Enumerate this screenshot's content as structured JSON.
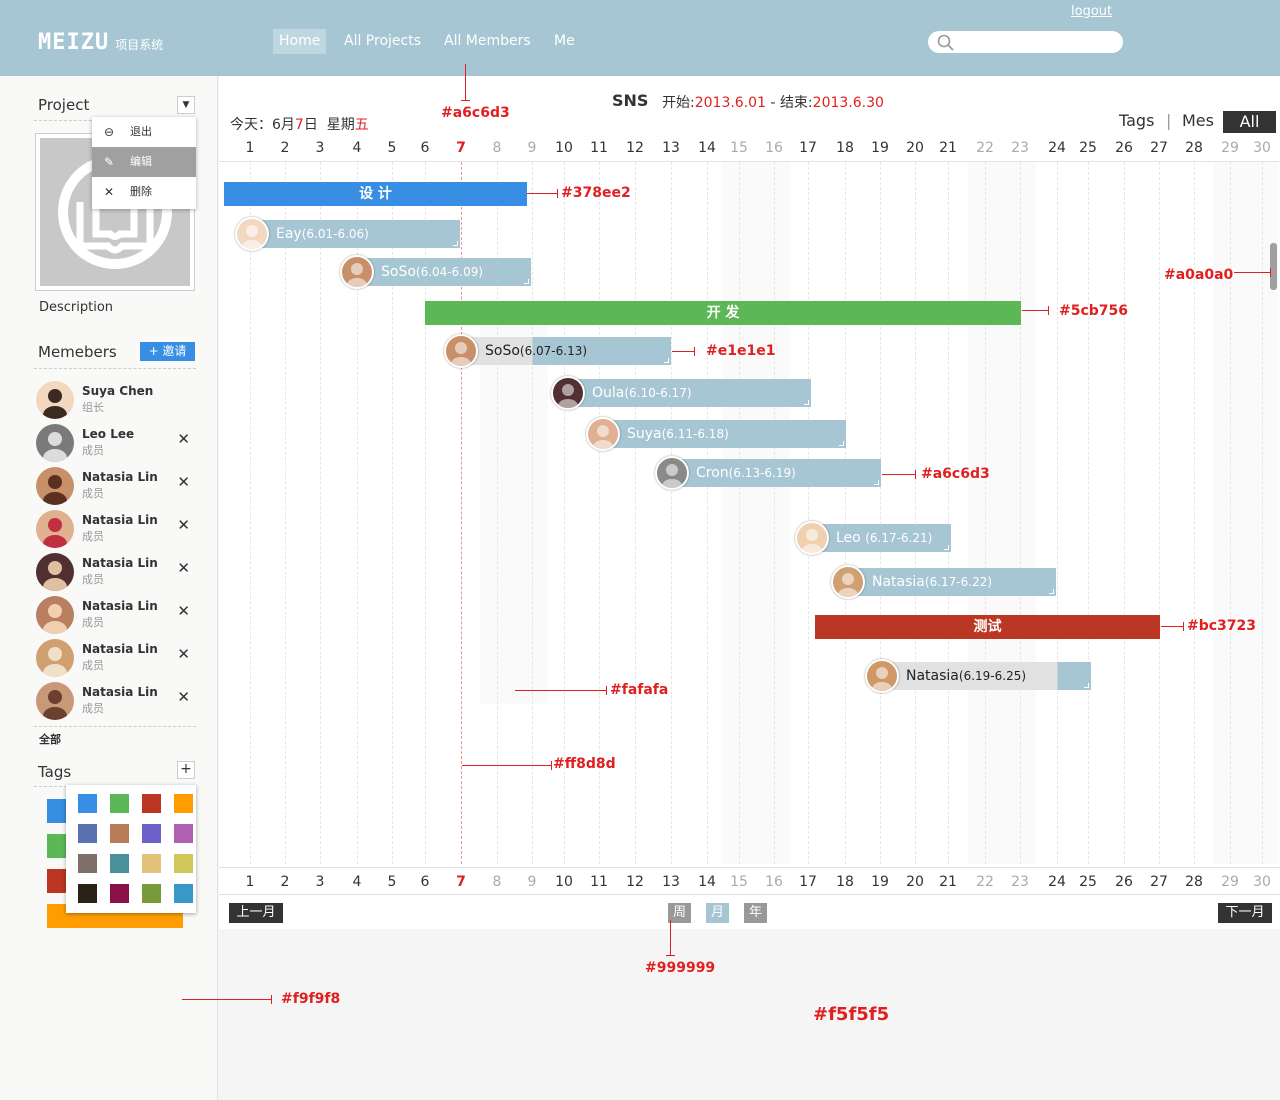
{
  "header": {
    "logo": "MEIZU",
    "logo_sub": "项目系统",
    "nav": [
      "Home",
      "All Projects",
      "All Members",
      "Me"
    ],
    "logout": "logout"
  },
  "sidebar": {
    "project_title": "Project",
    "menu": [
      "退出",
      "编辑",
      "删除"
    ],
    "description": "Description",
    "members_title": "Memebers",
    "invite": "+ 邀请",
    "members": [
      {
        "name": "Suya Chen",
        "role": "组长",
        "removable": false
      },
      {
        "name": "Leo Lee",
        "role": "成员",
        "removable": true
      },
      {
        "name": "Natasia Lin",
        "role": "成员",
        "removable": true
      },
      {
        "name": "Natasia Lin",
        "role": "成员",
        "removable": true
      },
      {
        "name": "Natasia Lin",
        "role": "成员",
        "removable": true
      },
      {
        "name": "Natasia Lin",
        "role": "成员",
        "removable": true
      },
      {
        "name": "Natasia Lin",
        "role": "成员",
        "removable": true
      },
      {
        "name": "Natasia Lin",
        "role": "成员",
        "removable": true
      }
    ],
    "all_link": "全部",
    "tags_title": "Tags",
    "tag_colors": [
      "#378ee2",
      "#5cb756",
      "#bc3723",
      "#ff9d00"
    ],
    "palette": [
      "#378ee2",
      "#5cb756",
      "#bc3723",
      "#ff9d00",
      "#5a73b0",
      "#b87c56",
      "#6c60c8",
      "#b060b0",
      "#7d7068",
      "#4a9098",
      "#e2c17a",
      "#d0c85a",
      "#2a2218",
      "#8a1048",
      "#789a38",
      "#3a98c8"
    ]
  },
  "project": {
    "name": "SNS",
    "start_label": "开始:",
    "start": "2013.6.01",
    "sep": " - ",
    "end_label": "结束:",
    "end": "2013.6.30"
  },
  "today": {
    "prefix": "今天：6月",
    "day": "7",
    "mid": "日  星期",
    "weekday": "五"
  },
  "view_tabs": {
    "tags": "Tags",
    "divider": "|",
    "mes": "Mes",
    "all": "All"
  },
  "days": [
    1,
    2,
    3,
    4,
    5,
    6,
    7,
    8,
    9,
    10,
    11,
    12,
    13,
    14,
    15,
    16,
    17,
    18,
    19,
    20,
    21,
    22,
    23,
    24,
    25,
    26,
    27,
    28,
    29,
    30
  ],
  "weekend_days": [
    8,
    9,
    15,
    16,
    22,
    23,
    29,
    30
  ],
  "today_day": 7,
  "phases": [
    {
      "name": "设 计",
      "color": "#378ee2",
      "start": 1,
      "end": 9
    },
    {
      "name": "开 发",
      "color": "#5cb756",
      "start": 6,
      "end": 23
    },
    {
      "name": "测试",
      "color": "#bc3723",
      "start": 17,
      "end": 27
    }
  ],
  "tasks": [
    {
      "name": "Eay",
      "range": "(6.01-6.06)",
      "dark": false
    },
    {
      "name": "SoSo",
      "range": "(6.04-6.09)",
      "dark": false
    },
    {
      "name": "SoSo",
      "range": "(6.07-6.13)",
      "dark": true,
      "progress": 0.34
    },
    {
      "name": "Oula",
      "range": "(6.10-6.17)",
      "dark": false
    },
    {
      "name": "Suya",
      "range": "(6.11-6.18)",
      "dark": false
    },
    {
      "name": "Cron",
      "range": "(6.13-6.19)",
      "dark": false
    },
    {
      "name": "Leo ",
      "range": "(6.17-6.21)",
      "dark": false
    },
    {
      "name": "Natasia",
      "range": "(6.17-6.22)",
      "dark": false
    },
    {
      "name": "Natasia",
      "range": "(6.19-6.25)",
      "dark": true,
      "progress": 0.84
    }
  ],
  "pager": {
    "prev": "上一月",
    "week": "周",
    "month": "月",
    "year": "年",
    "next": "下一月"
  },
  "annotations": [
    "#a6c6d3",
    "#378ee2",
    "#a0a0a0",
    "#5cb756",
    "#e1e1e1",
    "#a6c6d3",
    "#bc3723",
    "#fafafa",
    "#ff8d8d",
    "#999999",
    "#f9f9f8",
    "#f5f5f5"
  ]
}
